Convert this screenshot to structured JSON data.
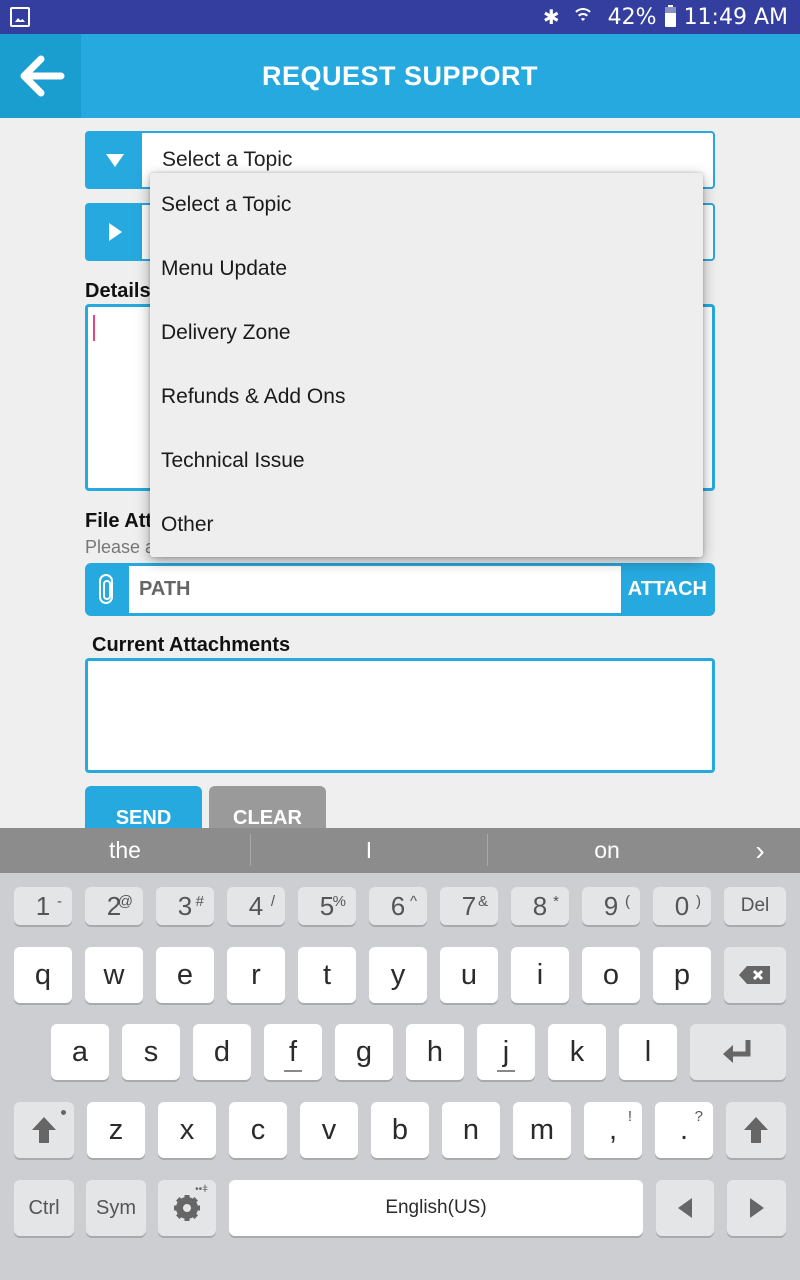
{
  "status_bar": {
    "notification_icon": "image-icon",
    "bluetooth_icon": "bluetooth-icon",
    "wifi_icon": "wifi-icon",
    "battery_percent": "42%",
    "battery_level": 0.42,
    "time": "11:49 AM"
  },
  "header": {
    "back_icon": "arrow-left-icon",
    "title": "REQUEST SUPPORT"
  },
  "form": {
    "topic_select": {
      "value": "Select a Topic",
      "icon": "triangle-down-icon"
    },
    "second_select": {
      "value": "",
      "icon": "triangle-right-icon"
    },
    "details_label": "Details",
    "details_value": "",
    "file_attachment_label": "File Att",
    "file_attachment_hint": "Please a",
    "path_placeholder": "PATH",
    "attach_label": "ATTACH",
    "current_attachments_label": "Current Attachments",
    "send_label": "SEND",
    "clear_label": "CLEAR"
  },
  "dropdown": {
    "options": [
      "Select a Topic",
      "Menu Update",
      "Delivery Zone",
      "Refunds & Add Ons",
      "Technical Issue",
      "Other"
    ]
  },
  "keyboard": {
    "suggestions": [
      "the",
      "I",
      "on"
    ],
    "suggest_more": "›",
    "number_row": [
      {
        "k": "1",
        "s": "-"
      },
      {
        "k": "2",
        "s": "@"
      },
      {
        "k": "3",
        "s": "#"
      },
      {
        "k": "4",
        "s": "/"
      },
      {
        "k": "5",
        "s": "%"
      },
      {
        "k": "6",
        "s": "^"
      },
      {
        "k": "7",
        "s": "&"
      },
      {
        "k": "8",
        "s": "*"
      },
      {
        "k": "9",
        "s": "("
      },
      {
        "k": "0",
        "s": ")"
      }
    ],
    "del_label": "Del",
    "row1": [
      "q",
      "w",
      "e",
      "r",
      "t",
      "y",
      "u",
      "i",
      "o",
      "p"
    ],
    "row2": [
      "a",
      "s",
      "d",
      "f",
      "g",
      "h",
      "j",
      "k",
      "l"
    ],
    "row3": [
      "z",
      "x",
      "c",
      "v",
      "b",
      "n",
      "m"
    ],
    "comma_key": {
      "k": ",",
      "s": "!"
    },
    "period_key": {
      "k": ".",
      "s": "?"
    },
    "ctrl_label": "Ctrl",
    "sym_label": "Sym",
    "space_label": "English(US)",
    "colors": {
      "accent": "#26a9df",
      "status_bar": "#343e9f",
      "clear_button": "#9a9a9a"
    }
  }
}
